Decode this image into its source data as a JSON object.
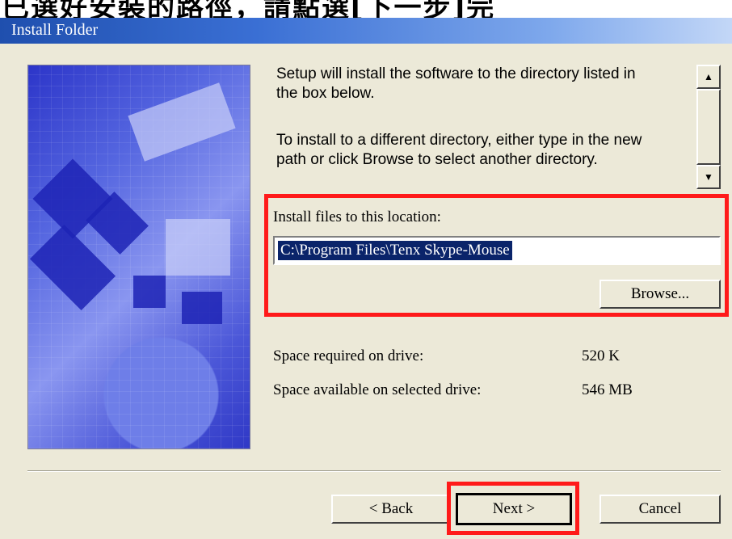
{
  "window": {
    "title": "Install Folder"
  },
  "top_caption": "已選好安裝的路徑，請點選[下一步]完",
  "description": {
    "line1": "Setup will install the software to the directory listed in",
    "line2": "the box below.",
    "line3": "To install to a different directory, either type in the new",
    "line4": "path or click Browse to select another directory."
  },
  "location": {
    "label": "Install files to this location:",
    "path": "C:\\Program Files\\Tenx Skype-Mouse",
    "browse_label": "Browse..."
  },
  "space": {
    "required_label": "Space required on drive:",
    "required_value": "520 K",
    "available_label": "Space available on selected drive:",
    "available_value": "546 MB"
  },
  "buttons": {
    "back": "< Back",
    "next": "Next >",
    "cancel": "Cancel"
  },
  "colors": {
    "highlight": "#ff1a1a",
    "selection": "#0a246a"
  }
}
